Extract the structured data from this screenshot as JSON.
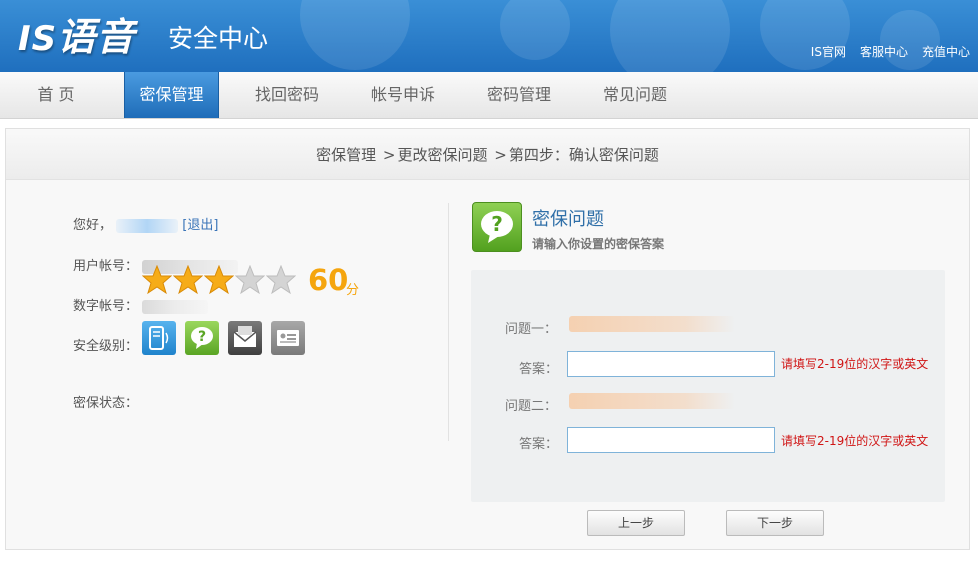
{
  "header": {
    "logo_latin": "IS",
    "logo_cjk": "语音",
    "site_title": "安全中心",
    "links": [
      "IS官网",
      "客服中心",
      "充值中心"
    ]
  },
  "nav": {
    "items": [
      "首 页",
      "密保管理",
      "找回密码",
      "帐号申诉",
      "密码管理",
      "常见问题"
    ],
    "active": "密保管理"
  },
  "breadcrumb": {
    "step1": "密保管理",
    "sep": ">",
    "step2": "更改密保问题",
    "step3": "第四步：确认密保问题"
  },
  "account": {
    "greeting": "您好，",
    "logout": "[退出]",
    "username_label": "用户帐号：",
    "number_label": "数字帐号：",
    "level_label": "安全级别：",
    "stars_filled": 3,
    "stars_total": 5,
    "score": "60",
    "score_unit": "分",
    "status_label": "密保状态：",
    "status_icons": [
      "phone-icon",
      "question-icon",
      "mail-icon",
      "id-card-icon"
    ]
  },
  "security_question": {
    "title": "密保问题",
    "subtitle": "请输入你设置的密保答案",
    "q1_label": "问题一：",
    "a1_label": "答案：",
    "a1_value": "",
    "a1_error": "请填写2-19位的汉字或英文",
    "q2_label": "问题二：",
    "a2_label": "答案：",
    "a2_value": "",
    "a2_error": "请填写2-19位的汉字或英文"
  },
  "buttons": {
    "prev": "上一步",
    "next": "下一步"
  }
}
